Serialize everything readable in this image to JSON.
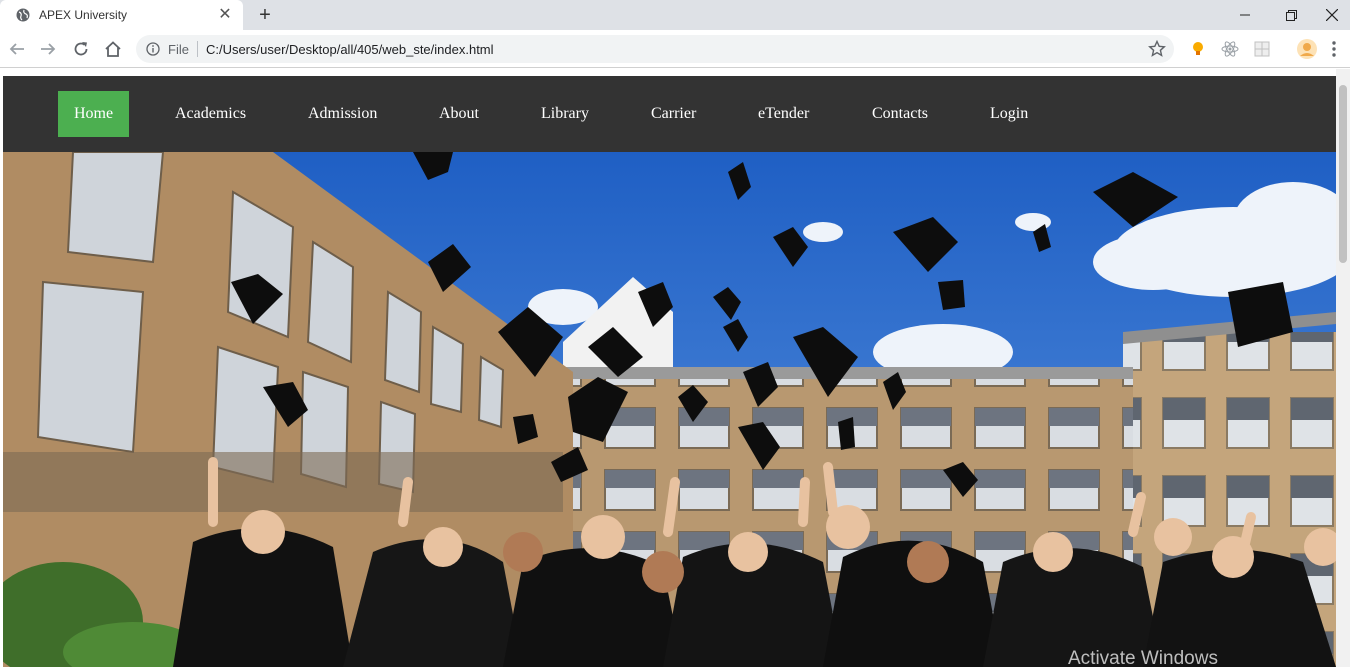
{
  "browser": {
    "tab_title": "APEX University",
    "url_scheme": "File",
    "url": "C:/Users/user/Desktop/all/405/web_ste/index.html"
  },
  "site": {
    "nav": [
      {
        "label": "Home",
        "active": true
      },
      {
        "label": "Academics"
      },
      {
        "label": "Admission"
      },
      {
        "label": "About"
      },
      {
        "label": "Library"
      },
      {
        "label": "Carrier"
      },
      {
        "label": "eTender"
      },
      {
        "label": "Contacts"
      },
      {
        "label": "Login"
      }
    ],
    "nav_bg": "#333333",
    "active_color": "#4caf50"
  },
  "os": {
    "watermark": "Activate Windows"
  }
}
